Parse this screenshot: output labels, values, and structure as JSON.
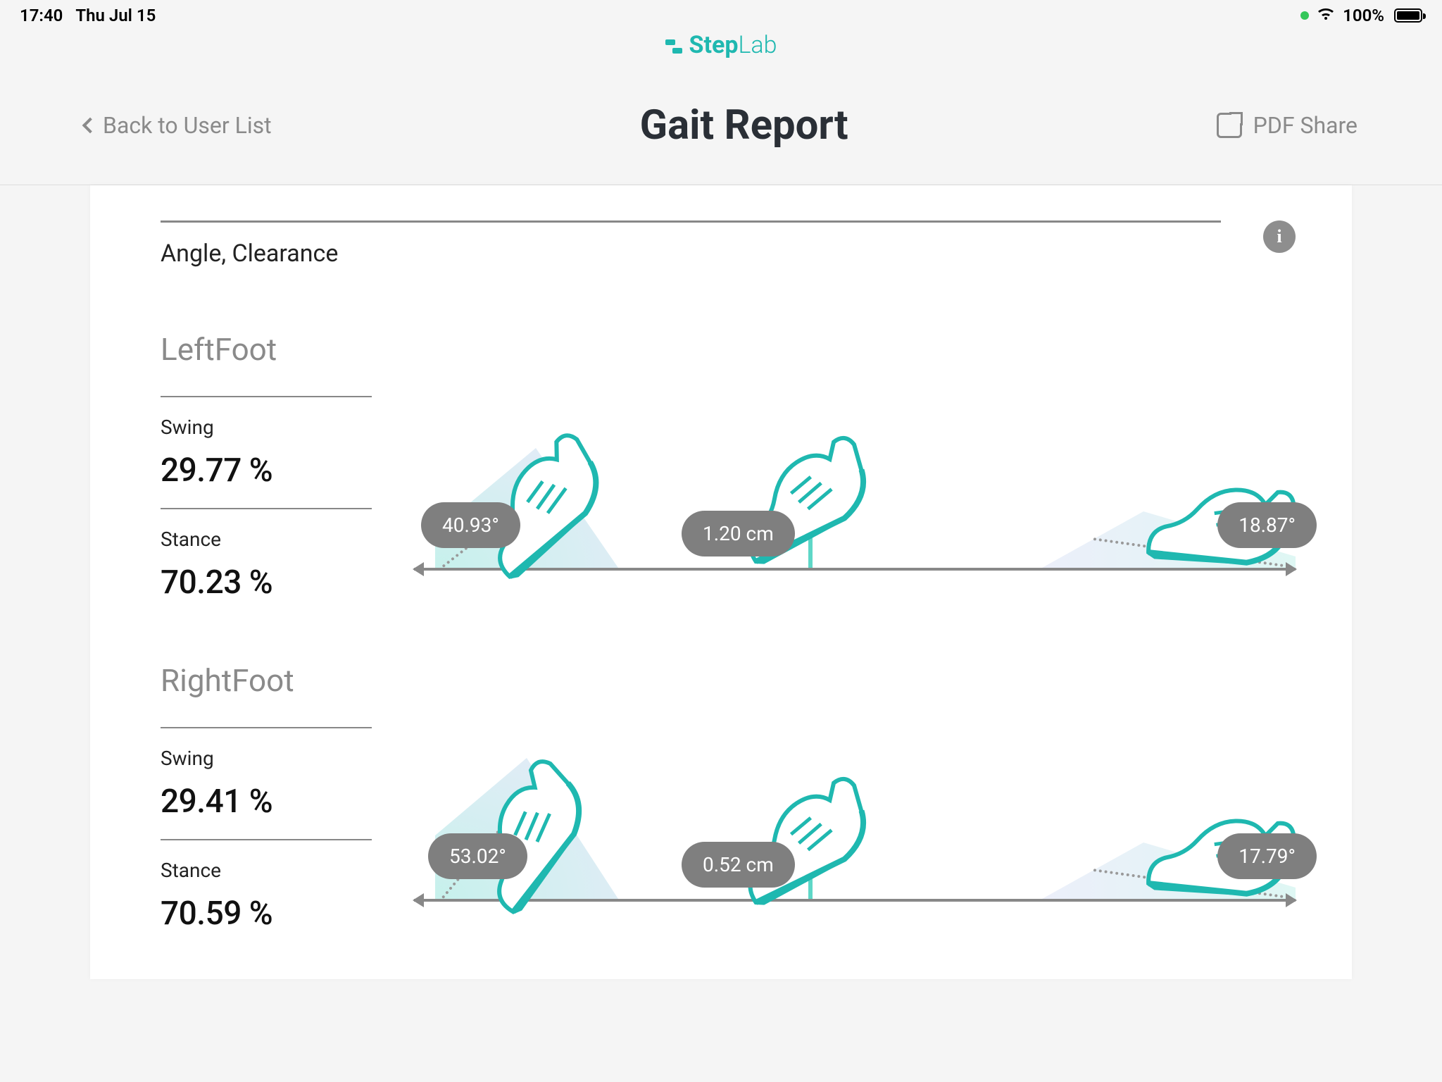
{
  "status": {
    "time": "17:40",
    "date": "Thu Jul 15",
    "battery": "100%"
  },
  "logo": {
    "main": "Step",
    "sub": "Lab"
  },
  "header": {
    "back": "Back to User List",
    "title": "Gait Report",
    "share": "PDF Share"
  },
  "section": {
    "title": "Angle, Clearance"
  },
  "left_foot": {
    "label": "LeftFoot",
    "swing_label": "Swing",
    "swing_value": "29.77 %",
    "stance_label": "Stance",
    "stance_value": "70.23 %",
    "angle_heel": "40.93°",
    "clearance": "1.20 cm",
    "angle_toe": "18.87°"
  },
  "right_foot": {
    "label": "RightFoot",
    "swing_label": "Swing",
    "swing_value": "29.41 %",
    "stance_label": "Stance",
    "stance_value": "70.59 %",
    "angle_heel": "53.02°",
    "clearance": "0.52 cm",
    "angle_toe": "17.79°"
  }
}
